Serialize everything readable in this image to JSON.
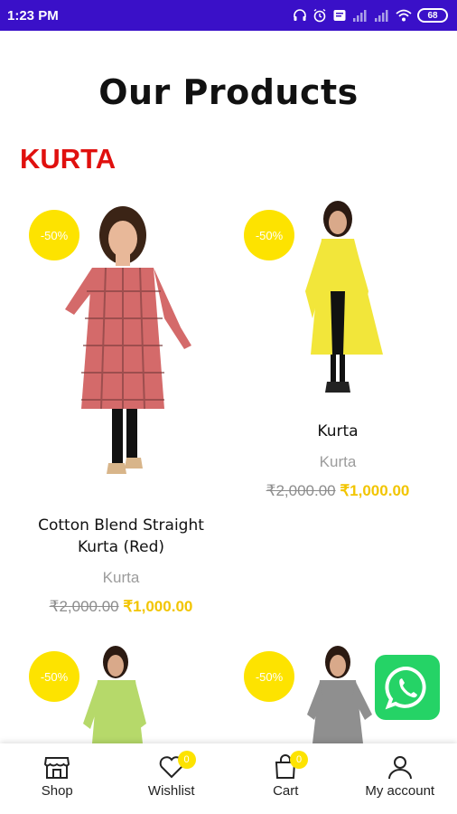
{
  "status_bar": {
    "time": "1:23 PM",
    "battery": "68"
  },
  "page": {
    "title": "Our Products",
    "category": "KURTA"
  },
  "products": [
    {
      "discount": "-50%",
      "name": "Cotton Blend Straight Kurta (Red)",
      "category": "Kurta",
      "old_price": "₹2,000.00",
      "new_price": "₹1,000.00",
      "color": "#d46a6a"
    },
    {
      "discount": "-50%",
      "name": "Kurta",
      "category": "Kurta",
      "old_price": "₹2,000.00",
      "new_price": "₹1,000.00",
      "color": "#f2e63a"
    },
    {
      "discount": "-50%",
      "color": "#b6d96a"
    },
    {
      "discount": "-50%",
      "color": "#8f8f8f"
    }
  ],
  "bottom_nav": {
    "shop": "Shop",
    "wishlist": "Wishlist",
    "wishlist_count": "0",
    "cart": "Cart",
    "cart_count": "0",
    "account": "My account"
  }
}
